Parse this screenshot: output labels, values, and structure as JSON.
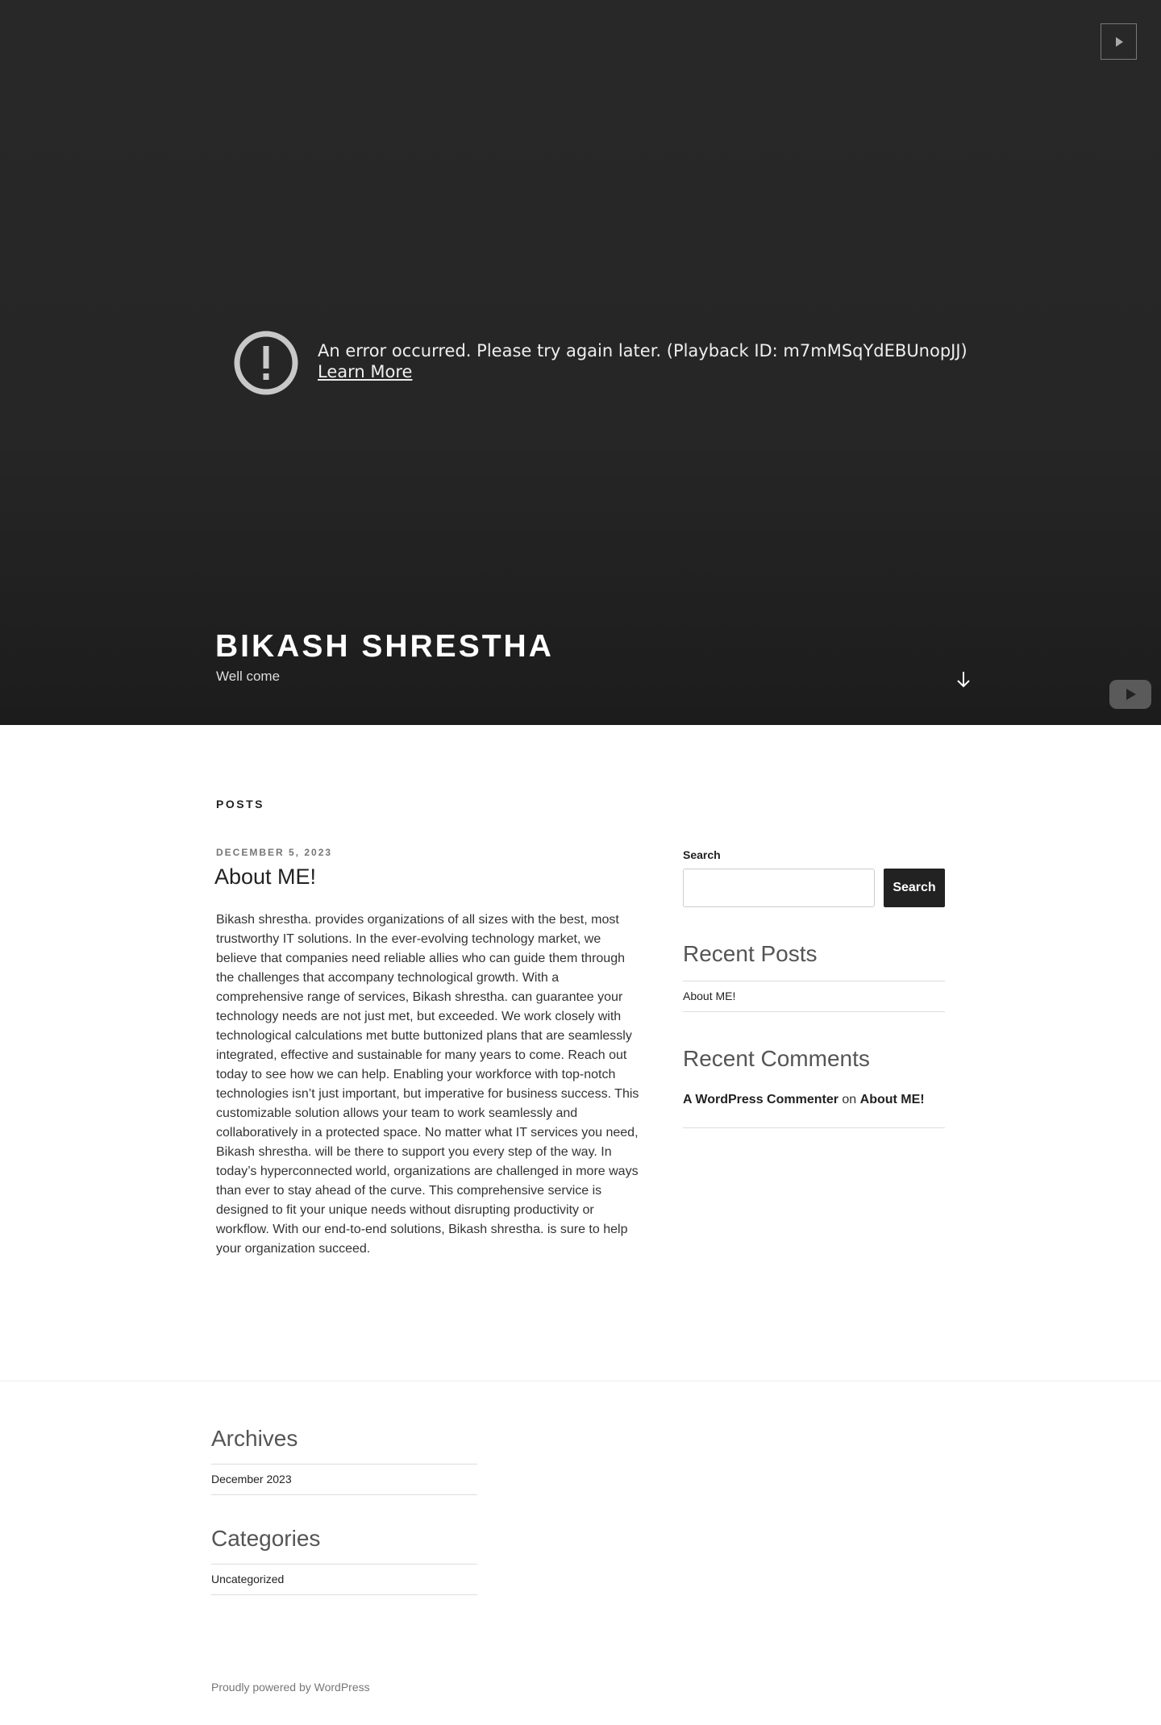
{
  "video": {
    "error_message": "An error occurred. Please try again later. (Playback ID: m7mMSqYdEBUnopJJ)",
    "learn_more": "Learn More"
  },
  "header": {
    "site_title": "BIKASH SHRESTHA",
    "site_description": "Well come"
  },
  "main": {
    "section_label": "POSTS",
    "post": {
      "date": "DECEMBER 5, 2023",
      "title": "About ME!",
      "body": "Bikash shrestha. provides organizations of all sizes with the best, most trustworthy IT solutions. In the ever-evolving technology market, we believe that companies need reliable allies who can guide them through the challenges that accompany technological growth. With a comprehensive range of services, Bikash shrestha. can guarantee your technology needs are not just met, but exceeded. We work closely with technological calculations met butte buttonized plans that are seamlessly integrated, effective and sustainable for many years to come. Reach out today to see how we can help. Enabling your workforce with top-notch technologies isn’t just important, but imperative for business success. This customizable solution allows your team to work seamlessly and collaboratively in a protected space. No matter what IT services you need, Bikash shrestha. will be there to support you every step of the way. In today’s hyperconnected world, organizations are challenged in more ways than ever to stay ahead of the curve. This comprehensive service is designed to fit your unique needs without disrupting productivity or workflow. With our end-to-end solutions, Bikash shrestha. is sure to help your organization succeed."
    }
  },
  "sidebar": {
    "search_label": "Search",
    "search_button": "Search",
    "search_value": "",
    "recent_posts_title": "Recent Posts",
    "recent_posts": [
      "About ME!"
    ],
    "recent_comments_title": "Recent Comments",
    "comment": {
      "author": "A WordPress Commenter",
      "connector": "on",
      "post": "About ME!"
    }
  },
  "footer": {
    "archives_title": "Archives",
    "archives": [
      "December 2023"
    ],
    "categories_title": "Categories",
    "categories": [
      "Uncategorized"
    ],
    "powered_by": "Proudly powered by WordPress"
  },
  "icons": {
    "play": "play-icon",
    "error": "exclamation-circle-icon",
    "scroll": "arrow-down-icon",
    "youtube": "youtube-logo-icon"
  }
}
